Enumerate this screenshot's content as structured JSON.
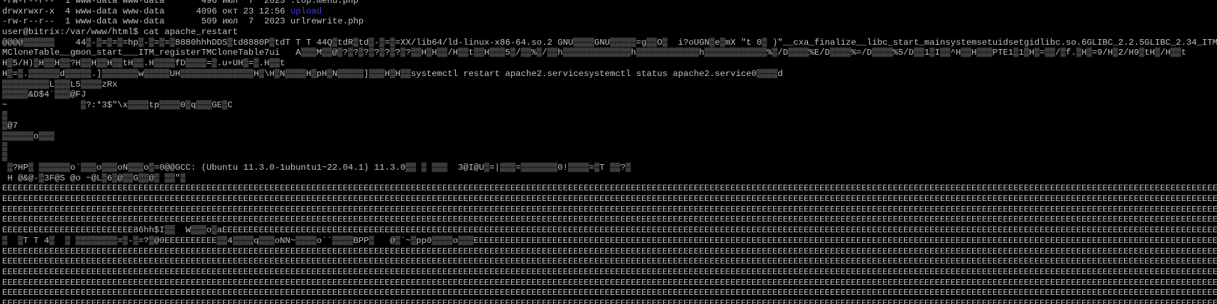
{
  "terminal": {
    "colors": {
      "background": "#000000",
      "text": "#c0c0c0",
      "directory": "#3b3bff"
    },
    "listing": [
      {
        "perms": "-rw-r--r--",
        "links": "1",
        "owner": "www-data",
        "group": "www-data",
        "size": "496",
        "date": "июл  7  2023",
        "name": ".top.menu.php",
        "is_dir": false
      },
      {
        "perms": "drwxrwxr-x",
        "links": "4",
        "owner": "www-data",
        "group": "www-data",
        "size": "4096",
        "date": "окт 23 12:56",
        "name": "upload",
        "is_dir": true
      },
      {
        "perms": "-rw-r--r--",
        "links": "1",
        "owner": "www-data",
        "group": "www-data",
        "size": "509",
        "date": "июл  7  2023",
        "name": "urlrewrite.php",
        "is_dir": false
      }
    ],
    "prompt": "user@bitrix:/var/www/html$",
    "command": "cat apache_restart",
    "binary_output": [
      "@@@@▒▒▒▒▒▒    44▒-▒=▒=▒=hp▒-▒=▒=▒8880hhhDDS▒td8880P▒tdT T T 44Q▒tdR▒td▒-▒=▒=XX/lib64/ld-linux-x86-64.so.2 GNU▒▒▒▒GNU▒▒▒▒▒=g▒▒O▒  i?oUGN▒e▒mX \"t 0▒ )\"__cxa_finalize__libc_start_mainsystemsetuidsetgidlibc.so.6GLIBC_2.2.5GLIBC_2.34_ITM_deregisterT",
      "MCloneTable__gmon_start___ITM_registerTMCloneTable7ui   A▒▒▒M▒▒@▒?▒?▒?▒?▒?▒?▒?▒▒H▒H▒▒/H▒▒t▒▒H▒▒▒5▒/▒▒%▒/▒▒h▒▒▒▒▒▒▒▒▒▒▒▒▒h▒▒▒▒▒▒▒▒▒▒▒▒h▒▒▒▒▒▒▒▒▒▒▒▒%▒/D▒▒▒▒%E/D▒▒▒▒%=/D▒▒▒▒%5/D▒▒1▒I▒▒^H▒▒H▒▒▒PTE1▒1▒H▒=▒▒/▒f.▒H▒=9/H▒2/H9▒tH▒/H▒▒t",
      "H▒5/H)▒H▒▒H▒▒?H▒▒H▒▒H▒▒tH▒▒.H▒▒▒▒fD▒▒▒▒=▒.u+UH▒=▒.H▒▒t",
      "H▒=▒.▒▒▒▒▒▒d▒▒▒▒▒.]▒▒▒▒▒▒▒w▒▒▒▒▒UH▒▒▒▒▒▒▒▒▒▒▒▒▒▒H▒\\H▒N▒▒▒▒H▒pH▒N▒▒▒▒▒]▒▒▒H▒H▒▒systemctl restart apache2.servicesystemctl status apache2.service0▒▒▒▒d",
      "▒▒▒▒▒▒▒▒▒L▒▒▒L5▒▒▒▒zRx",
      "▒▒▒▒▒&D$4`▒▒▒@FJ",
      "~              ▒?:*3$\"\\x▒▒▒▒tp▒▒▒▒0▒q▒▒▒GE▒C",
      "▒",
      "▒@7",
      "▒▒▒▒▒▒o▒▒▒",
      "▒",
      "▒",
      " ▒?HP▒ ▒▒▒▒▒▒o`▒▒▒o▒▒▒oN▒▒▒o▒=0@@GCC: (Ubuntu 11.3.0-1ubuntu1~22.04.1) 11.3.0▒▒ ▒ ▒▒▒  3@I@U▒=|▒▒▒=▒▒▒▒▒▒▒0!▒▒▒▒=▒T ▒▒?▒",
      " H @&@-▒3F@S @o ~@L▒6▒@▒▒G▒▒@▒ ▒▒\"▒"
    ],
    "fill_rows": [
      "EEEEEEEEEEEEEEEEEEEEEEEEEEEEEEEEEEEEEEEEEEEEEEEEEEEEEEEEEEEEEEEEEEEEEEEEEEEEEEEEEEEEEEEEEEEEEEEEEEEEEEEEEEEEEEEEEEEEEEEEEEEEEEEEEEEEEEEEEEEEEEEEEEEEEEEEEEEEEEEEEEEEEEEEEEEEEEEEEEEEEEEEEEEEEEEEEEEEEEEEEEEEEEEEEEEEEEEEEEEEEEEEEEEEEEEEEEEEEEEEEEEEEE",
      "EEEEEEEEEEEEEEEEEEEEEEEEEEEEEEEEEEEEEEEEEEEEEEEEEEEEEEEEEEEEEEEEEEEEEEEEEEEEEEEEEEEEEEEEEEEEEEEEEEEEEEEEEEEEEEEEEEEEEEEEEEEEEEEEEEEEEEEEEEEEEEEEEEEEEEEEEEEEEEEEEEEEEEEEEEEEEEEEEEEEEEEEEEEEEEEEEEEEEEEEEEEEEEEEEEEEEEEEEEEEEEEEEEEEEEEEEEEEEEEEEEEEEEE",
      "EEEEEEEEEEEEEEEEEEEEEEEEEEEEEEEEEEEEEEEEEEEEEEEEEEEEEEEEEEEEEEEEEEEEEEEEEEEEEEEEEEEEEEEEEEEEEEEEEEEEEEEEEEEEEEEEEEEEEEEEEEEEEEEEEEEEEEEEEEEEEEEEEEEEEEEEEEEEEEEEEEEEEEEEEEEEEEEEEEEEEEEEEEEEEEEEEEEEEEEEEEEEEEEEEEEEEEEEEEEEEEEEEEEEEEEEEEEEEEEEEEEEEEEE",
      "EEEEEEEEEEEEEEEEEEEEEEEEEEEEEEEEEEEEEEEEEEEEEEEEEEEEEEEEEEEEEEEEEEEEEEEEEEEEEEEEEEEEEEEEEEEEEEEEEEEEEEEEEEEEEEEEEEEEEEEEEEEEEEEEEEEEEEEEEEEEEEEEEEEEEEEEEEEEEEEEEEEEEEEEEEEEEEEEEEEEEEEEEEEEEEEEEEEEEEEEEEEEEEEEEEEEEEEEEEEEEEEEEEEEEEEEEEEEEEEEEEEEEEEE",
      "EEEEEEEEEEEEEEEEEEEEEEEEE86hh$I▒▒  W▒▒▒o▒aEEEEEEEEEEEEEEEEEEEEEEEEEEEEEEEEEEEEEEEEEEEEEEEEEEEEEEEEEEEEEEEEEEEEEEEEEEEEEEEEEEEEEEEEEEEEEEEEEEEEEEEEEEEEEEEEEEEEEEEEEEEEEEEEEEEEEEEEEEEEEEEEEEEEEEEEEEEEEEEEEEEEEEEEEEEEEEEEEEEEEEEEEEEEEEEEEEEEEEEEEEEEEEEEEEEEEEEEEEEEEEEEEEEEEE",
      "▒  ▒T T 4▒  ▒ ▒▒▒▒▒▒▒▒=▒-▒=?▒@0EEEEEEEEEE▒▒4▒▒▒▒q▒▒▒oNN~▒▒▒▒o``▒▒▒▒BPP▒   @▒`~▒pp0▒▒▒▒o▒▒▒EEEEEEEEEEEEEEEEEEEEEEEEEEEEEEEEEEEEEEEEEEEEEEEEEEEEEEEEEEEEEEEEEEEEEEEEEEEEEEEEEEEEEEEEEEEEEEEEEEEEEEEEEEEEEEEEEEEEEEEEEEEEEEEEEEEEEEEEEEEEEEEEEEEEEEEEEEEEE",
      "EEEEEEEEEEEEEEEEEEEEEEEEEEEEEEEEEEEEEEEEEEEEEEEEEEEEEEEEEEEEEEEEEEEEEEEEEEEEEEEEEEEEEEEEEEEEEEEEEEEEEEEEEEEEEEEEEEEEEEEEEEEEEEEEEEEEEEEEEEEEEEEEEEEEEEEEEEEEEEEEEEEEEEEEEEEEEEEEEEEEEEEEEEEEEEEEEEEEEEEEEEEEEEEEEEEEEEEEEEEEEEEEEEEEEEEEEEEEEEEEEEEEEEE",
      "EEEEEEEEEEEEEEEEEEEEEEEEEEEEEEEEEEEEEEEEEEEEEEEEEEEEEEEEEEEEEEEEEEEEEEEEEEEEEEEEEEEEEEEEEEEEEEEEEEEEEEEEEEEEEEEEEEEEEEEEEEEEEEEEEEEEEEEEEEEEEEEEEEEEEEEEEEEEEEEEEEEEEEEEEEEEEEEEEEEEEEEEEEEEEEEEEEEEEEEEEEEEEEEEEEEEEEEEEEEEEEEEEEEEEEEEEEEEEEEEEEEEEEEEE",
      "EEEEEEEEEEEEEEEEEEEEEEEEEEEEEEEEEEEEEEEEEEEEEEEEEEEEEEEEEEEEEEEEEEEEEEEEEEEEEEEEEEEEEEEEEEEEEEEEEEEEEEEEEEEEEEEEEEEEEEEEEEEEEEEEEEEEEEEEEEEEEEEEEEEEEEEEEEEEEEEEEEEEEEEEEEEEEEEEEEEEEEEEEEEEEEEEEEEEEEEEEEEEEEEEEEEEEEEEEEEEEEEEEEEEEEEEEEEEEEEEEEEEEE",
      "EEEEEEEEEEEEEEEEEEEEEEEEEEEEEEEEEEEEEEEEEEEEEEEEEEEEEEEEEEEEEEEEEEEEEEEEEEEEEEEEEEEEEEEEEEEEEEEEEEEEEEEEEEEEEEEEEEEEEEEEEEEEEEEEEEEEEEEEEEEEEEEEEEEEEEEEEEEEEEEEEEEEEEEEEEEEEEEEEEEEEEEEEEEEEEEEEEEEEEEEEEEEEEEEEEEEEEEEEEEEEEEEEEEEEEEEEEEEEEEEEEEEEEE",
      "EEEEEEEEEEEEEEEEEEEEEEEEEEEEEEEEEEEEEEEEEEEEEEEEEEEEEEEEEEEEEEEEEEEEEEEEEEEEEEEEEEEEEEEEEEEEEEEEEEEEEEEEEEEEEEEEEEEEEEEEEEEEEEEEEEEEEEEEEEEEEEEEEEEEEEEEEEEEEEEEEEEEEEEEEEEEEEEEEEEEEEEEEEEEEEEEEEEEEEEEEEEEEEEEEEEEEEEEEEEEEEEEEEEEEEEEEEEEEEEEEEEEEEE",
      "EEEEEEEEEEEEEEEEEEEEEEEEEEEEEEEEEEEEEEEEEEEEEEEEEEEEEEEEEEEEEEEEEEEEEEEEEEEEEEEEEEEEEEEEEEEEEEEEEEEEEEEEEEEEEEEEEEEEEEEEEEEEEEEEEEEEEEEEEEEEEEEEEEEEEEEEEEEEEEEEEEEEEEEEEEEEEEEEEEEEEEEEEEEEEEEEEEEEEEEEEEEEEEEEEEEEEEEEEEEEEEEEEEEEEEEEEEEEEEEEEEEEEE"
    ]
  }
}
